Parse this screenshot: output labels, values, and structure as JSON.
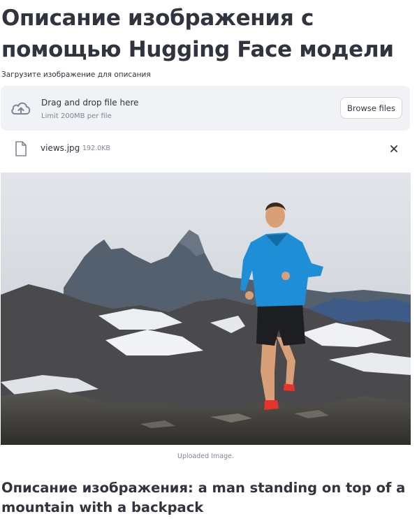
{
  "header": {
    "title": "Описание изображения с помощью Hugging Face модели"
  },
  "uploader": {
    "label": "Загрузите изображение для описания",
    "drop_text": "Drag and drop file here",
    "limit_text": "Limit 200MB per file",
    "browse_label": "Browse files",
    "upload_icon": "cloud-upload-icon"
  },
  "file": {
    "name": "views.jpg",
    "size": "192.0KB",
    "icon": "file-icon",
    "remove_icon": "close-icon"
  },
  "image": {
    "caption": "Uploaded Image."
  },
  "result": {
    "text": "Описание изображения: a man standing on top of a mountain with a backpack"
  },
  "colors": {
    "text": "#31333f",
    "muted": "#808495",
    "dropzone_bg": "#f0f2f6",
    "jacket": "#1e8fd6",
    "shoes": "#e8322b"
  }
}
